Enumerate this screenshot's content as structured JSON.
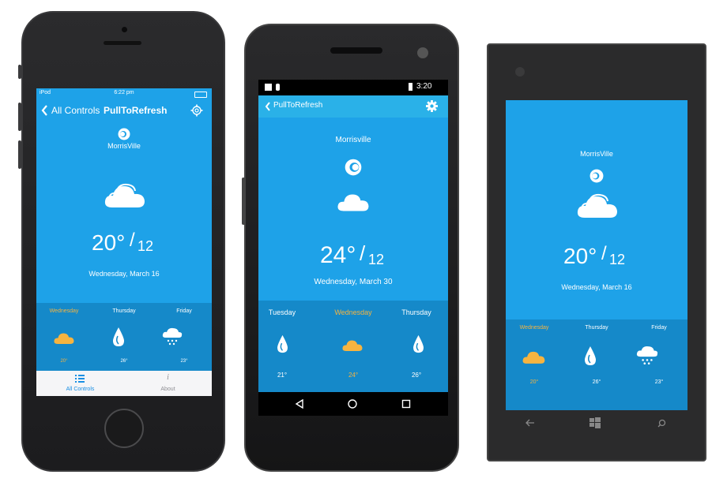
{
  "iphone": {
    "status": {
      "carrier": "iPod",
      "time": "6:22 pm"
    },
    "nav": {
      "back_label": "All Controls",
      "title": "PullToRefresh"
    },
    "city": "MorrisVille",
    "temp_high": "20°",
    "temp_low": "12",
    "date": "Wednesday, March 16",
    "forecast": [
      {
        "day": "Wednesday",
        "icon": "cloud-icon",
        "temp": "20°"
      },
      {
        "day": "Thursday",
        "icon": "rain-drop-icon",
        "temp": "26°"
      },
      {
        "day": "Friday",
        "icon": "snow-cloud-icon",
        "temp": "23°"
      }
    ],
    "tabs": [
      {
        "label": "All Controls",
        "icon": "list-icon"
      },
      {
        "label": "About",
        "icon": "info-icon"
      }
    ]
  },
  "android": {
    "status": {
      "time": "3:20"
    },
    "nav": {
      "title": "PullToRefresh"
    },
    "city": "Morrisville",
    "temp_high": "24°",
    "temp_low": "12",
    "date": "Wednesday, March 30",
    "forecast": [
      {
        "day": "Tuesday",
        "icon": "rain-drop-icon",
        "temp": "21°"
      },
      {
        "day": "Wednesday",
        "icon": "cloud-icon",
        "temp": "24°"
      },
      {
        "day": "Thursday",
        "icon": "rain-drop-icon",
        "temp": "26°"
      }
    ]
  },
  "winphone": {
    "city": "MorrisVille",
    "temp_high": "20°",
    "temp_low": "12",
    "date": "Wednesday, March 16",
    "forecast": [
      {
        "day": "Wednesday",
        "icon": "cloud-icon",
        "temp": "20°"
      },
      {
        "day": "Thursday",
        "icon": "rain-drop-icon",
        "temp": "26°"
      },
      {
        "day": "Friday",
        "icon": "snow-cloud-icon",
        "temp": "23°"
      }
    ]
  },
  "colors": {
    "screen_bg": "#1ea2e8",
    "forecast_bg": "#1589c9",
    "nav_bar": "#2ab1e8",
    "highlight": "#f6b440",
    "ios_tabbar": "#f5f5f7",
    "ios_tab_active": "#1a8fe3"
  }
}
